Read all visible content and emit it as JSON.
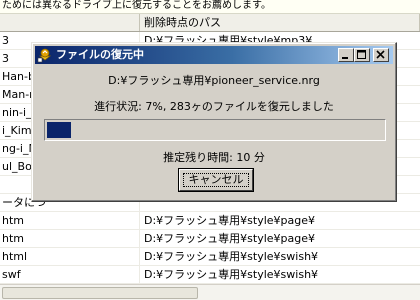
{
  "background_window": {
    "notice": "ためには異なるドライブ上に復元することをお薦めします。",
    "columns": [
      "",
      "削除時点のパス"
    ],
    "rows": [
      {
        "name": "3",
        "path": "D:¥フラッシュ専用¥style¥mp3¥"
      },
      {
        "name": "3",
        "path": ""
      },
      {
        "name": "Han-b",
        "path": ""
      },
      {
        "name": "Man-n",
        "path": ""
      },
      {
        "name": "nin-i_M",
        "path": ""
      },
      {
        "name": "i_Kim_",
        "path": ""
      },
      {
        "name": "ng-i_M",
        "path": ""
      },
      {
        "name": "ul_Bo-",
        "path": ""
      },
      {
        "name": "",
        "path": ""
      },
      {
        "name": "ータにつ",
        "path": ""
      },
      {
        "name": "htm",
        "path": "D:¥フラッシュ専用¥style¥page¥"
      },
      {
        "name": "htm",
        "path": "D:¥フラッシュ専用¥style¥page¥"
      },
      {
        "name": "html",
        "path": "D:¥フラッシュ専用¥style¥swish¥"
      },
      {
        "name": "swf",
        "path": "D:¥フラッシュ専用¥style¥swish¥"
      },
      {
        "name": "swi",
        "path": "D:¥フラッシュ専用¥style¥swish¥"
      }
    ]
  },
  "dialog": {
    "title": "ファイルの復元中",
    "icon": "recycle-restore-icon",
    "file_path": "D:¥フラッシュ専用¥pioneer_service.nrg",
    "status": "進行状況: 7%, 283ヶのファイルを復元しました",
    "progress_percent": 7,
    "remaining": "推定残り時間: 10 分",
    "cancel_label": "キャンセル",
    "title_buttons": [
      "minimize-icon",
      "maximize-icon",
      "close-icon"
    ]
  }
}
